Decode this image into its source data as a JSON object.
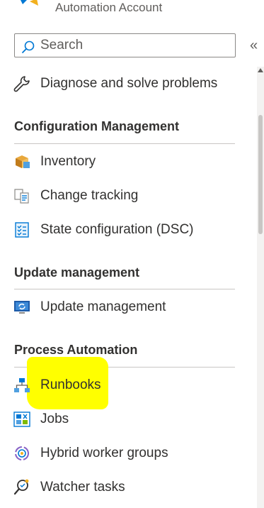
{
  "header": {
    "subtitle": "Automation Account"
  },
  "search": {
    "placeholder": "Search"
  },
  "collapse": {
    "glyph": "«"
  },
  "top_items": [
    {
      "label": "Diagnose and solve problems",
      "icon": "wrench-icon"
    }
  ],
  "sections": [
    {
      "title": "Configuration Management",
      "items": [
        {
          "label": "Inventory",
          "icon": "inventory-boxes-icon"
        },
        {
          "label": "Change tracking",
          "icon": "change-tracking-icon"
        },
        {
          "label": "State configuration (DSC)",
          "icon": "checklist-icon"
        }
      ]
    },
    {
      "title": "Update management",
      "items": [
        {
          "label": "Update management",
          "icon": "monitor-update-icon"
        }
      ]
    },
    {
      "title": "Process Automation",
      "items": [
        {
          "label": "Runbooks",
          "icon": "hierarchy-icon"
        },
        {
          "label": "Jobs",
          "icon": "jobs-grid-icon"
        },
        {
          "label": "Hybrid worker groups",
          "icon": "hybrid-worker-icon"
        },
        {
          "label": "Watcher tasks",
          "icon": "watcher-search-icon"
        }
      ]
    }
  ],
  "colors": {
    "highlight": "#ffff00",
    "accent_blue": "#0078d4"
  }
}
